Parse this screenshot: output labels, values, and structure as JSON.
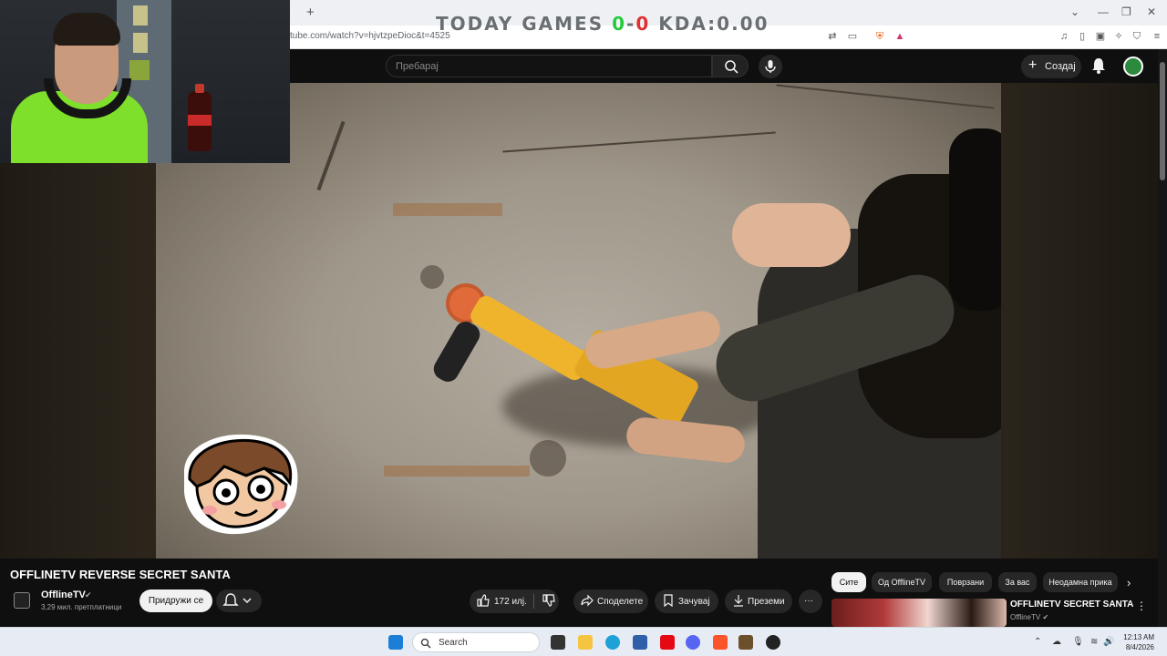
{
  "browser": {
    "url": "tube.com/watch?v=hjvtzpeDioc&t=4525",
    "new_tab_label": "+",
    "window_controls": [
      "⌄",
      "—",
      "❐",
      "✕"
    ]
  },
  "overlay": {
    "today_games_label": "TODAY GAMES",
    "wins": "0",
    "dash": "-",
    "losses": "0",
    "kda_label": "KDA:0.00"
  },
  "youtube_header": {
    "search_placeholder": "Пребарај",
    "create_label": "Создај"
  },
  "video": {
    "title": "OFFLINETV REVERSE SECRET SANTA",
    "channel_name": "OfflineTV",
    "verified_mark": "✔",
    "subscribers": "3,29 мил. претплатници",
    "join_label": "Придружи се",
    "like_count": "172 илј.",
    "share_label": "Споделете",
    "save_label": "Зачувај",
    "download_label": "Преземи",
    "more_label": "···"
  },
  "chips": [
    {
      "label": "Сите",
      "active": true
    },
    {
      "label": "Од OfflineTV",
      "active": false
    },
    {
      "label": "Поврзани",
      "active": false
    },
    {
      "label": "За вас",
      "active": false
    },
    {
      "label": "Неодамна прика",
      "active": false
    }
  ],
  "recommendation": {
    "title": "OFFLINETV SECRET SANTA",
    "channel": "OfflineTV",
    "verified_mark": "✔"
  },
  "taskbar": {
    "search_label": "Search",
    "time": "12:13 AM",
    "date": "8/4/2026"
  },
  "colors": {
    "win_green": "#27c93f",
    "loss_red": "#e03131",
    "youtube_dark": "#0f0f0f",
    "chip_dark": "#272727"
  }
}
